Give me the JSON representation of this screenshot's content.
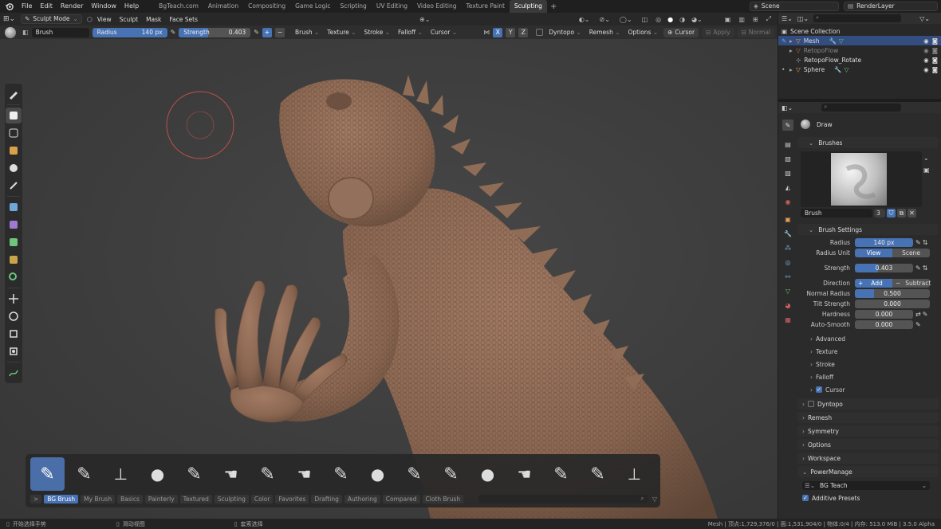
{
  "topbar": {
    "menus": [
      "File",
      "Edit",
      "Render",
      "Window",
      "Help"
    ],
    "workspaces": [
      "BgTeach.com",
      "Animation",
      "Compositing",
      "Game Logic",
      "Scripting",
      "UV Editing",
      "Video Editing",
      "Texture Paint",
      "Sculpting"
    ],
    "active_workspace": "Sculpting",
    "scene": "Scene",
    "view_layer": "RenderLayer"
  },
  "viewport_header": {
    "mode": "Sculpt Mode",
    "menus": [
      "View",
      "Sculpt",
      "Mask",
      "Face Sets"
    ]
  },
  "tool_header": {
    "brush_name": "Brush",
    "radius_label": "Radius",
    "radius_value": "140 px",
    "strength_label": "Strength",
    "strength_value": "0.403",
    "dropdowns": [
      "Brush",
      "Texture",
      "Stroke",
      "Falloff",
      "Cursor"
    ],
    "axes": [
      "X",
      "Y",
      "Z"
    ],
    "right_dropdowns": [
      "Dyntopo",
      "Remesh",
      "Options"
    ],
    "cursor_label": "Cursor",
    "apply_label": "Apply",
    "normal_label": "Normal"
  },
  "outliner": {
    "root": "Scene Collection",
    "items": [
      {
        "name": "Mesh",
        "selected": true
      },
      {
        "name": "RetopoFlow",
        "selected": false
      },
      {
        "name": "RetopoFlow_Rotate",
        "selected": false
      },
      {
        "name": "Sphere",
        "selected": false
      }
    ]
  },
  "properties": {
    "active_tool": "Draw",
    "brushes_panel": "Brushes",
    "brush_field": "Brush",
    "brush_users": "3",
    "brush_settings_panel": "Brush Settings",
    "radius": {
      "label": "Radius",
      "value": "140 px"
    },
    "radius_unit": {
      "label": "Radius Unit",
      "options": [
        "View",
        "Scene"
      ],
      "selected": "View"
    },
    "strength": {
      "label": "Strength",
      "value": "0.403",
      "fraction": 0.403
    },
    "direction": {
      "label": "Direction",
      "add": "Add",
      "subtract": "Subtract"
    },
    "normal_radius": {
      "label": "Normal Radius",
      "value": "0.500",
      "fraction": 0.5
    },
    "tilt_strength": {
      "label": "Tilt Strength",
      "value": "0.000"
    },
    "hardness": {
      "label": "Hardness",
      "value": "0.000"
    },
    "auto_smooth": {
      "label": "Auto-Smooth",
      "value": "0.000"
    },
    "subpanels": [
      "Advanced",
      "Texture",
      "Stroke",
      "Falloff",
      "Cursor"
    ],
    "panels": [
      "Dyntopo",
      "Remesh",
      "Symmetry",
      "Options",
      "Workspace",
      "PowerManage"
    ],
    "powermanage_value": "BG Teach",
    "additive_presets": "Additive Presets"
  },
  "brushbar": {
    "categories": [
      "BG Brush",
      "My Brush",
      "Basics",
      "Painterly",
      "Textured",
      "Sculpting",
      "Color",
      "Favorites",
      "Drafting",
      "Authoring",
      "Compared",
      "Cloth Brush"
    ],
    "active_category": "BG Brush",
    "expand_label": ">"
  },
  "statusbar": {
    "left1": "开始选择手势",
    "left2": "滑动视图",
    "left3": "套索选择",
    "right": "Mesh | 顶点:1,729,376/0 | 面:1,531,904/0 | 物体:0/4 | 内存: 513.0 MiB | 3.5.0 Alpha"
  },
  "colors": {
    "accent": "#4772b3",
    "selection": "#334d80",
    "brush_cursor": "#c85050"
  }
}
